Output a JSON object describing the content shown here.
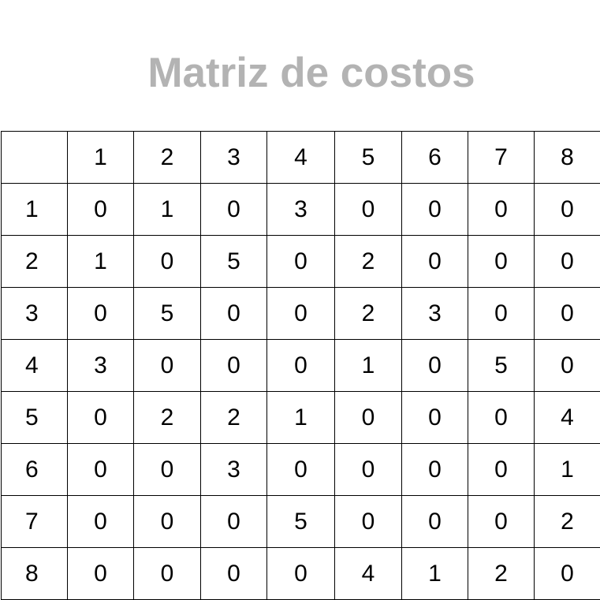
{
  "title": "Matriz de costos",
  "matrix": {
    "corner": "",
    "columns": [
      "1",
      "2",
      "3",
      "4",
      "5",
      "6",
      "7",
      "8"
    ],
    "rows": [
      {
        "label": "1",
        "cells": [
          "0",
          "1",
          "0",
          "3",
          "0",
          "0",
          "0",
          "0"
        ]
      },
      {
        "label": "2",
        "cells": [
          "1",
          "0",
          "5",
          "0",
          "2",
          "0",
          "0",
          "0"
        ]
      },
      {
        "label": "3",
        "cells": [
          "0",
          "5",
          "0",
          "0",
          "2",
          "3",
          "0",
          "0"
        ]
      },
      {
        "label": "4",
        "cells": [
          "3",
          "0",
          "0",
          "0",
          "1",
          "0",
          "5",
          "0"
        ]
      },
      {
        "label": "5",
        "cells": [
          "0",
          "2",
          "2",
          "1",
          "0",
          "0",
          "0",
          "4"
        ]
      },
      {
        "label": "6",
        "cells": [
          "0",
          "0",
          "3",
          "0",
          "0",
          "0",
          "0",
          "1"
        ]
      },
      {
        "label": "7",
        "cells": [
          "0",
          "0",
          "0",
          "5",
          "0",
          "0",
          "0",
          "2"
        ]
      },
      {
        "label": "8",
        "cells": [
          "0",
          "0",
          "0",
          "0",
          "4",
          "1",
          "2",
          "0"
        ]
      }
    ]
  },
  "colors": {
    "title": "#b3b3b3",
    "text": "#000000",
    "border": "#000000",
    "background": "#ffffff"
  }
}
